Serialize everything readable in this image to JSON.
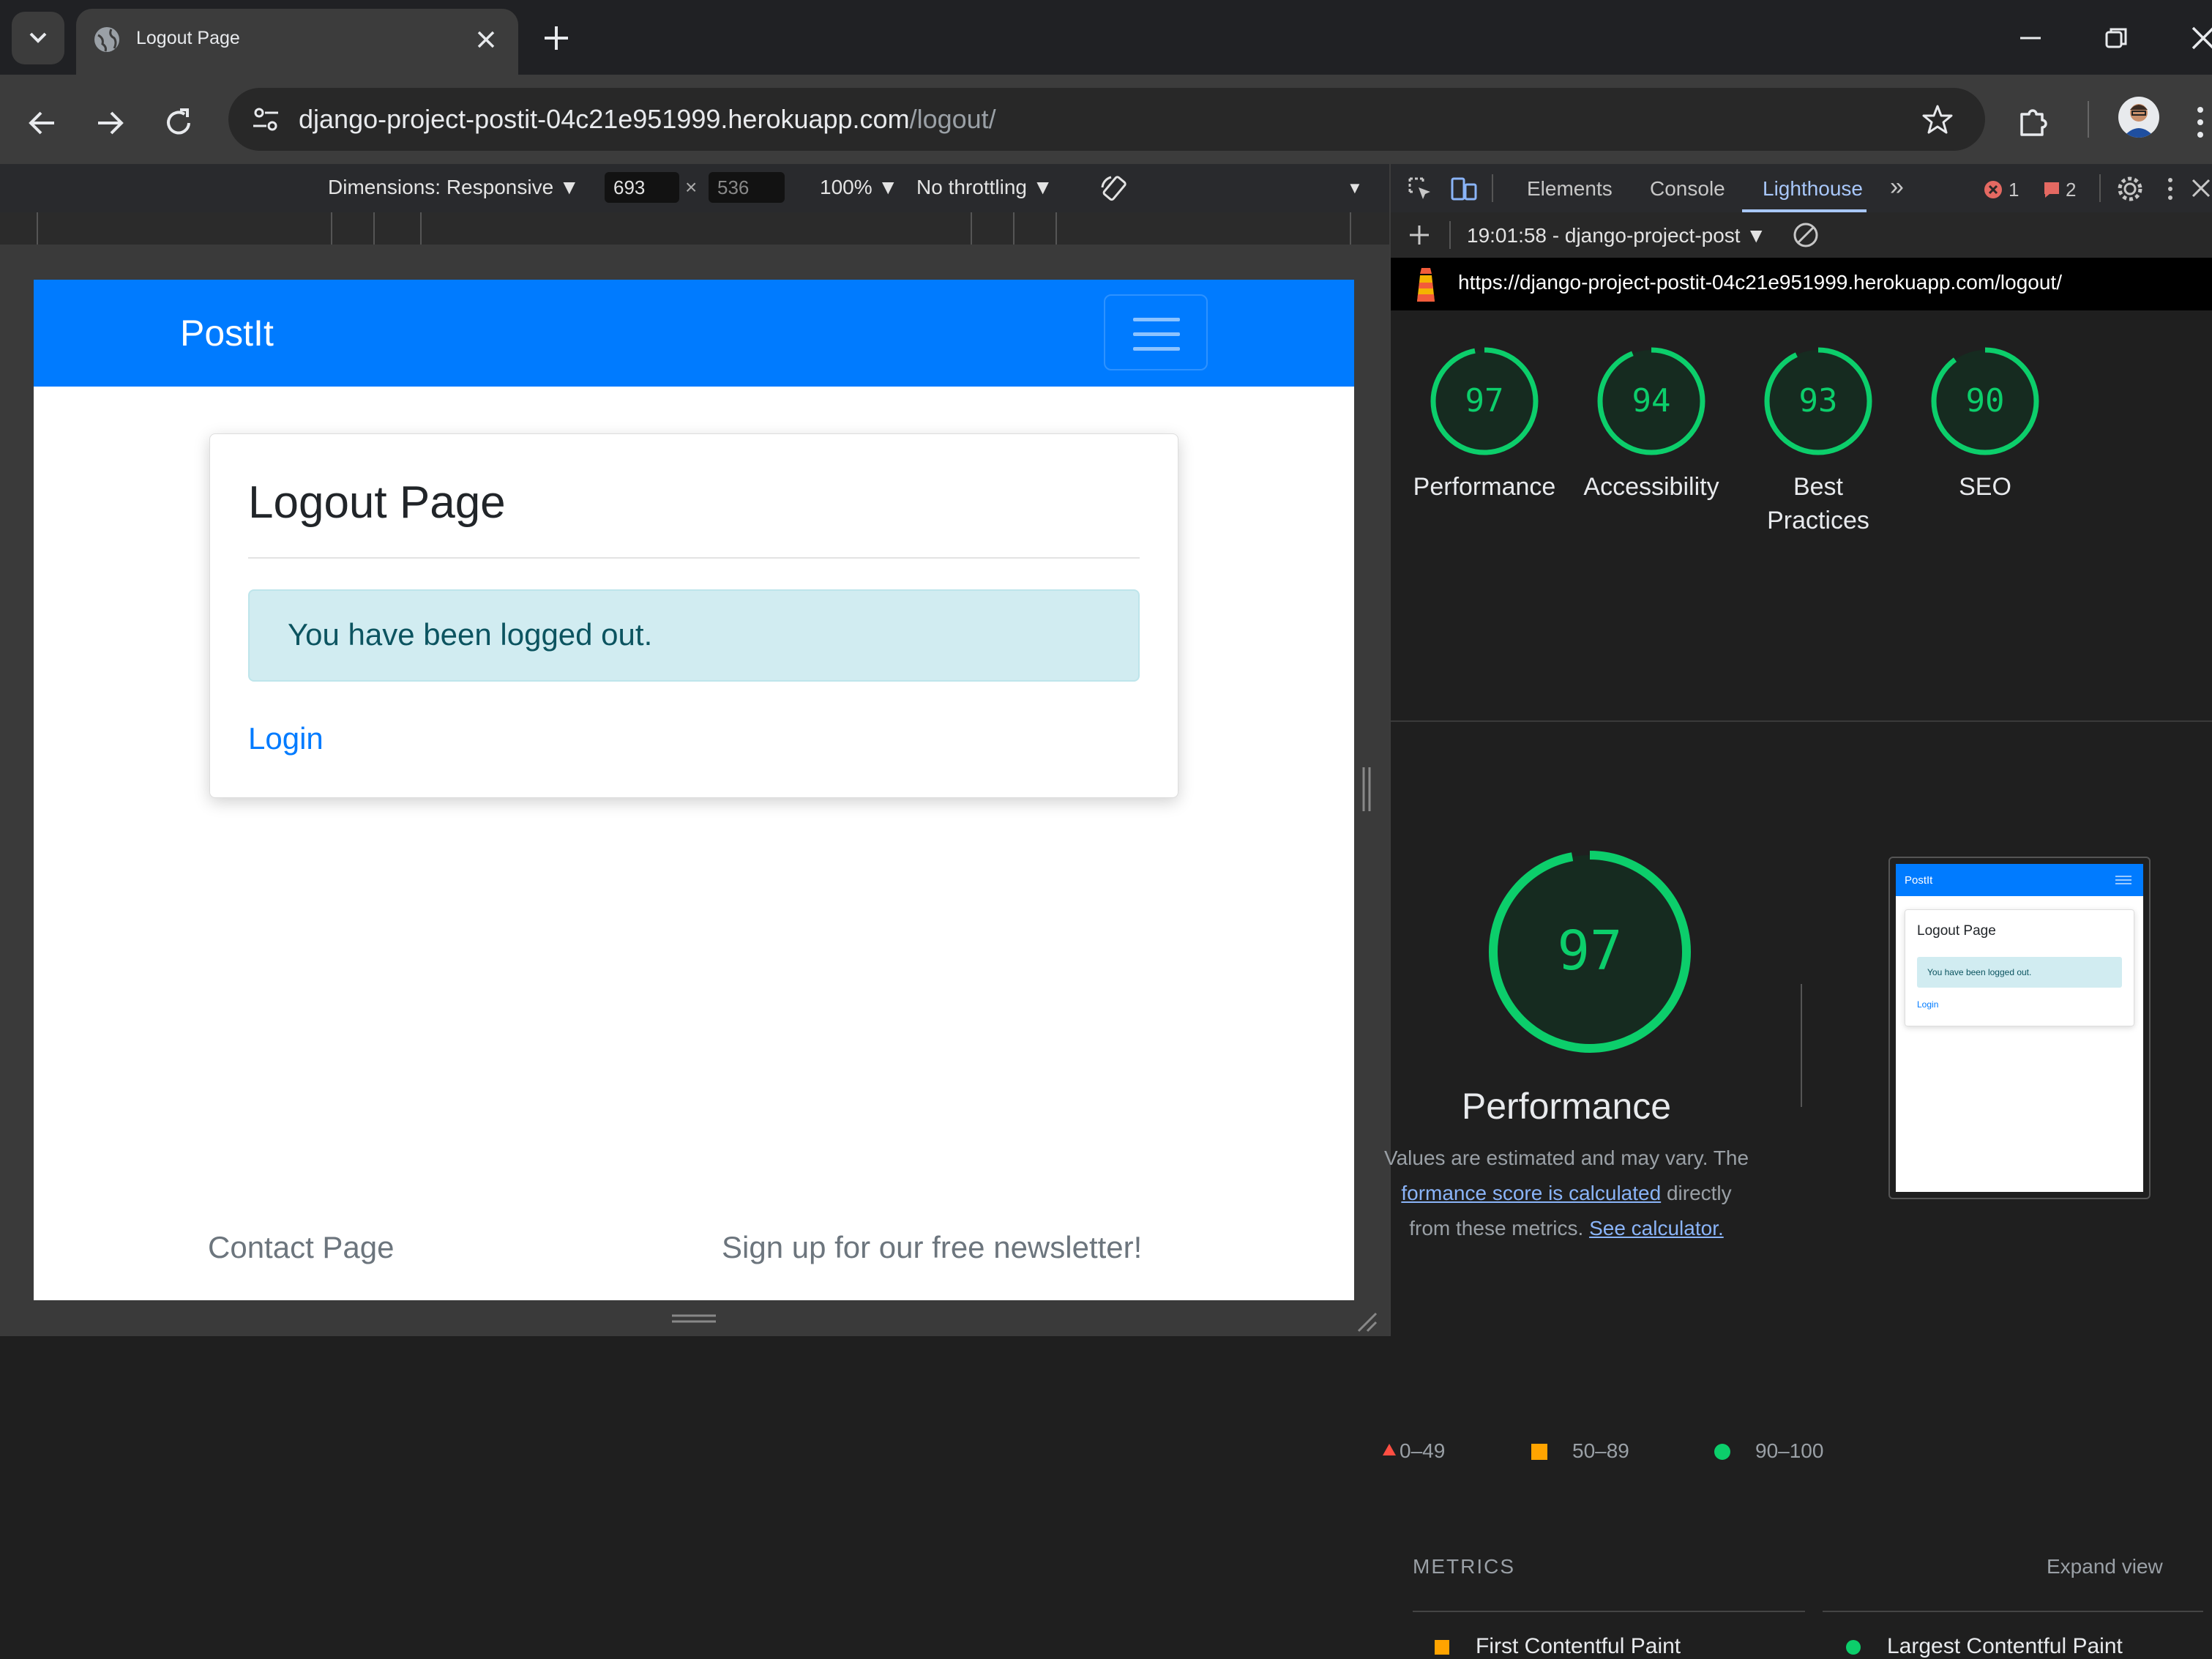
{
  "browser": {
    "tab": {
      "title": "Logout Page"
    },
    "url": {
      "main": "django-project-postit-04c21e951999.herokuapp.com",
      "path": "/logout/"
    }
  },
  "device_toolbar": {
    "dimensions_label": "Dimensions: Responsive",
    "width": "693",
    "height": "536",
    "times": "×",
    "zoom": "100%",
    "throttling": "No throttling"
  },
  "page": {
    "brand": "PostIt",
    "card_title": "Logout Page",
    "alert_text": "You have been logged out.",
    "login_link": "Login",
    "footer_contact": "Contact Page",
    "footer_newsletter": "Sign up for our free newsletter!"
  },
  "devtools": {
    "tabs": {
      "elements": "Elements",
      "console": "Console",
      "lighthouse": "Lighthouse"
    },
    "errors_count": "1",
    "issues_count": "2",
    "report_selector": "19:01:58 - django-project-post",
    "report_url": "https://django-project-postit-04c21e951999.herokuapp.com/logout/",
    "colors": {
      "pass": "#0cce6b",
      "average": "#ffa400",
      "fail": "#ff4e42"
    },
    "scores": [
      {
        "value": "97",
        "label": "Performance"
      },
      {
        "value": "94",
        "label": "Accessibility"
      },
      {
        "value": "93",
        "label": "Best Practices"
      },
      {
        "value": "90",
        "label": "SEO"
      }
    ],
    "main_score": {
      "value": "97",
      "label": "Performance"
    },
    "description": {
      "part1": "Values are estimated and may vary. The ",
      "link1": "formance score is calculated",
      "part2": " directly from these metrics. ",
      "link2": "See calculator."
    },
    "legend": {
      "fail": "0–49",
      "average": "50–89",
      "pass": "90–100"
    },
    "metrics_heading": "METRICS",
    "expand_view": "Expand view",
    "metric_names": [
      "First Contentful Paint",
      "Largest Contentful Paint"
    ],
    "thumbnail": {
      "brand": "PostIt",
      "title": "Logout Page",
      "alert": "You have been logged out.",
      "link": "Login"
    }
  }
}
